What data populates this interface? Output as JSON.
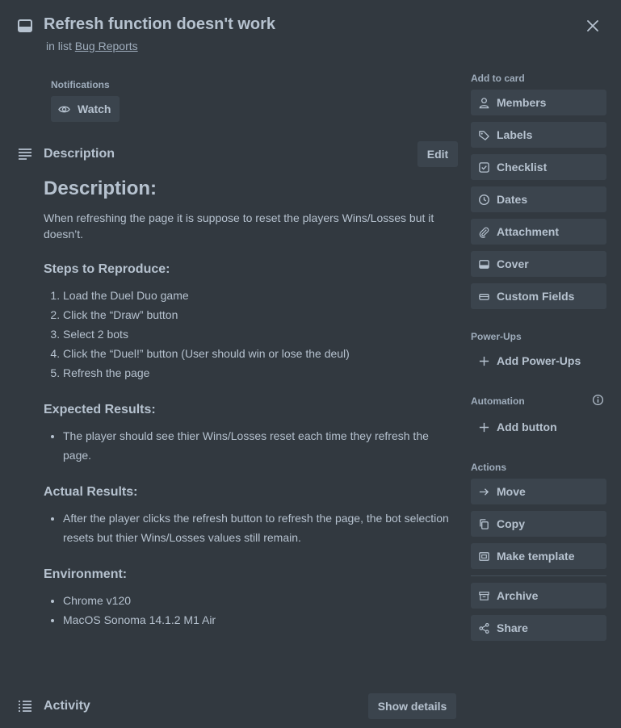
{
  "card": {
    "title": "Refresh function doesn't work",
    "in_list_prefix": "in list",
    "list_name": "Bug Reports"
  },
  "notifications": {
    "heading": "Notifications",
    "watch_label": "Watch"
  },
  "description": {
    "heading": "Description",
    "edit_label": "Edit",
    "doc_title": "Description:",
    "intro": "When refreshing the page it is suppose to reset the players Wins/Losses but it doesn’t.",
    "steps_heading": "Steps to Reproduce:",
    "steps": [
      "Load the Duel Duo game",
      "Click the “Draw” button",
      "Select 2 bots",
      "Click the “Duel!” button (User should win or lose the deul)",
      "Refresh the page"
    ],
    "expected_heading": "Expected Results:",
    "expected": [
      "The player should see thier Wins/Losses reset each time they refresh the page."
    ],
    "actual_heading": "Actual Results:",
    "actual": [
      "After the player clicks the refresh button to refresh the page, the bot selection resets but thier Wins/Losses values still remain."
    ],
    "environment_heading": "Environment:",
    "environment": [
      "Chrome v120",
      "MacOS Sonoma 14.1.2 M1 Air"
    ]
  },
  "activity": {
    "heading": "Activity",
    "show_details_label": "Show details"
  },
  "sidebar": {
    "add_to_card_heading": "Add to card",
    "add_to_card": [
      {
        "label": "Members",
        "icon": "person-icon"
      },
      {
        "label": "Labels",
        "icon": "tag-icon"
      },
      {
        "label": "Checklist",
        "icon": "checkbox-icon"
      },
      {
        "label": "Dates",
        "icon": "clock-icon"
      },
      {
        "label": "Attachment",
        "icon": "paperclip-icon"
      },
      {
        "label": "Cover",
        "icon": "cover-icon"
      },
      {
        "label": "Custom Fields",
        "icon": "custom-fields-icon"
      }
    ],
    "powerups_heading": "Power-Ups",
    "add_powerups_label": "Add Power-Ups",
    "automation_heading": "Automation",
    "add_button_label": "Add button",
    "actions_heading": "Actions",
    "actions": [
      {
        "label": "Move",
        "icon": "arrow-right-icon"
      },
      {
        "label": "Copy",
        "icon": "copy-icon"
      },
      {
        "label": "Make template",
        "icon": "template-icon"
      },
      {
        "label": "Archive",
        "icon": "archive-icon"
      },
      {
        "label": "Share",
        "icon": "share-icon"
      }
    ]
  },
  "colors": {
    "background": "#323940",
    "button": "#3b444d",
    "text": "#b6c2cf",
    "subtle_text": "#9fadbc"
  }
}
